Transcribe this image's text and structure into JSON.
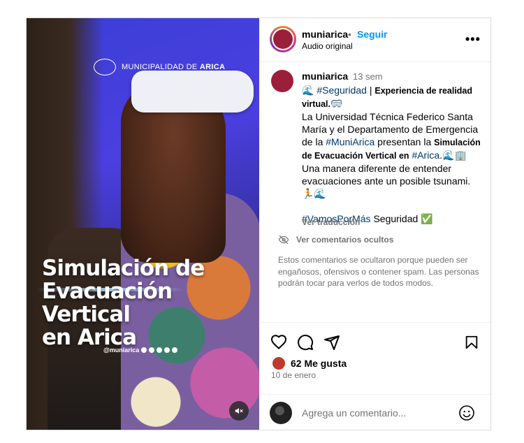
{
  "media": {
    "logo_text_prefix": "MUNICIPALIDAD DE",
    "logo_text_bold": "ARICA",
    "headline_lines": [
      "Simulación de",
      "Evacuación Vertical",
      "en Arica"
    ],
    "handle": "@muniarica",
    "mute_icon": "speaker-muted-icon"
  },
  "header": {
    "username": "muniarica",
    "separator": "•",
    "follow_label": "Seguir",
    "audio_label": "Audio original",
    "more_label": "•••"
  },
  "caption": {
    "username": "muniarica",
    "time": "13 sem",
    "wave1": "🌊",
    "tag_seguridad": "#Seguridad",
    "pipe": " | ",
    "bold1": "Experiencia de realidad virtual.",
    "vr_emoji": "🥽",
    "text1": "La Universidad Técnica Federico Santa María y el Departamento de Emergencia de la ",
    "tag_muniarica": "#MuniArica",
    "text2": " presentan la ",
    "bold2": "Simulación de Evacuación Vertical en",
    "text3": " ",
    "tag_arica": "#Arica",
    "text4": ".",
    "emoji_end": "🌊🏢",
    "text5": "Una manera diferente de entender evacuaciones ante un posible tsunami.",
    "emoji_line": "🏃🌊",
    "tag_vamos": "#VamosPorMás",
    "text6": " Seguridad ",
    "check": "✅",
    "translate_label": "Ver traducción"
  },
  "hidden_comments": {
    "label": "Ver comentarios ocultos",
    "note": "Estos comentarios se ocultaron porque pueden ser engañosos, ofensivos o contener spam. Las personas podrán tocar para verlos de todos modos."
  },
  "likes": {
    "count_label": "62 Me gusta",
    "date": "10 de enero"
  },
  "comment": {
    "placeholder": "Agrega un comentario..."
  },
  "colors": {
    "accent": "#0095f6",
    "hashtag": "#00376b",
    "muted": "#737373"
  }
}
